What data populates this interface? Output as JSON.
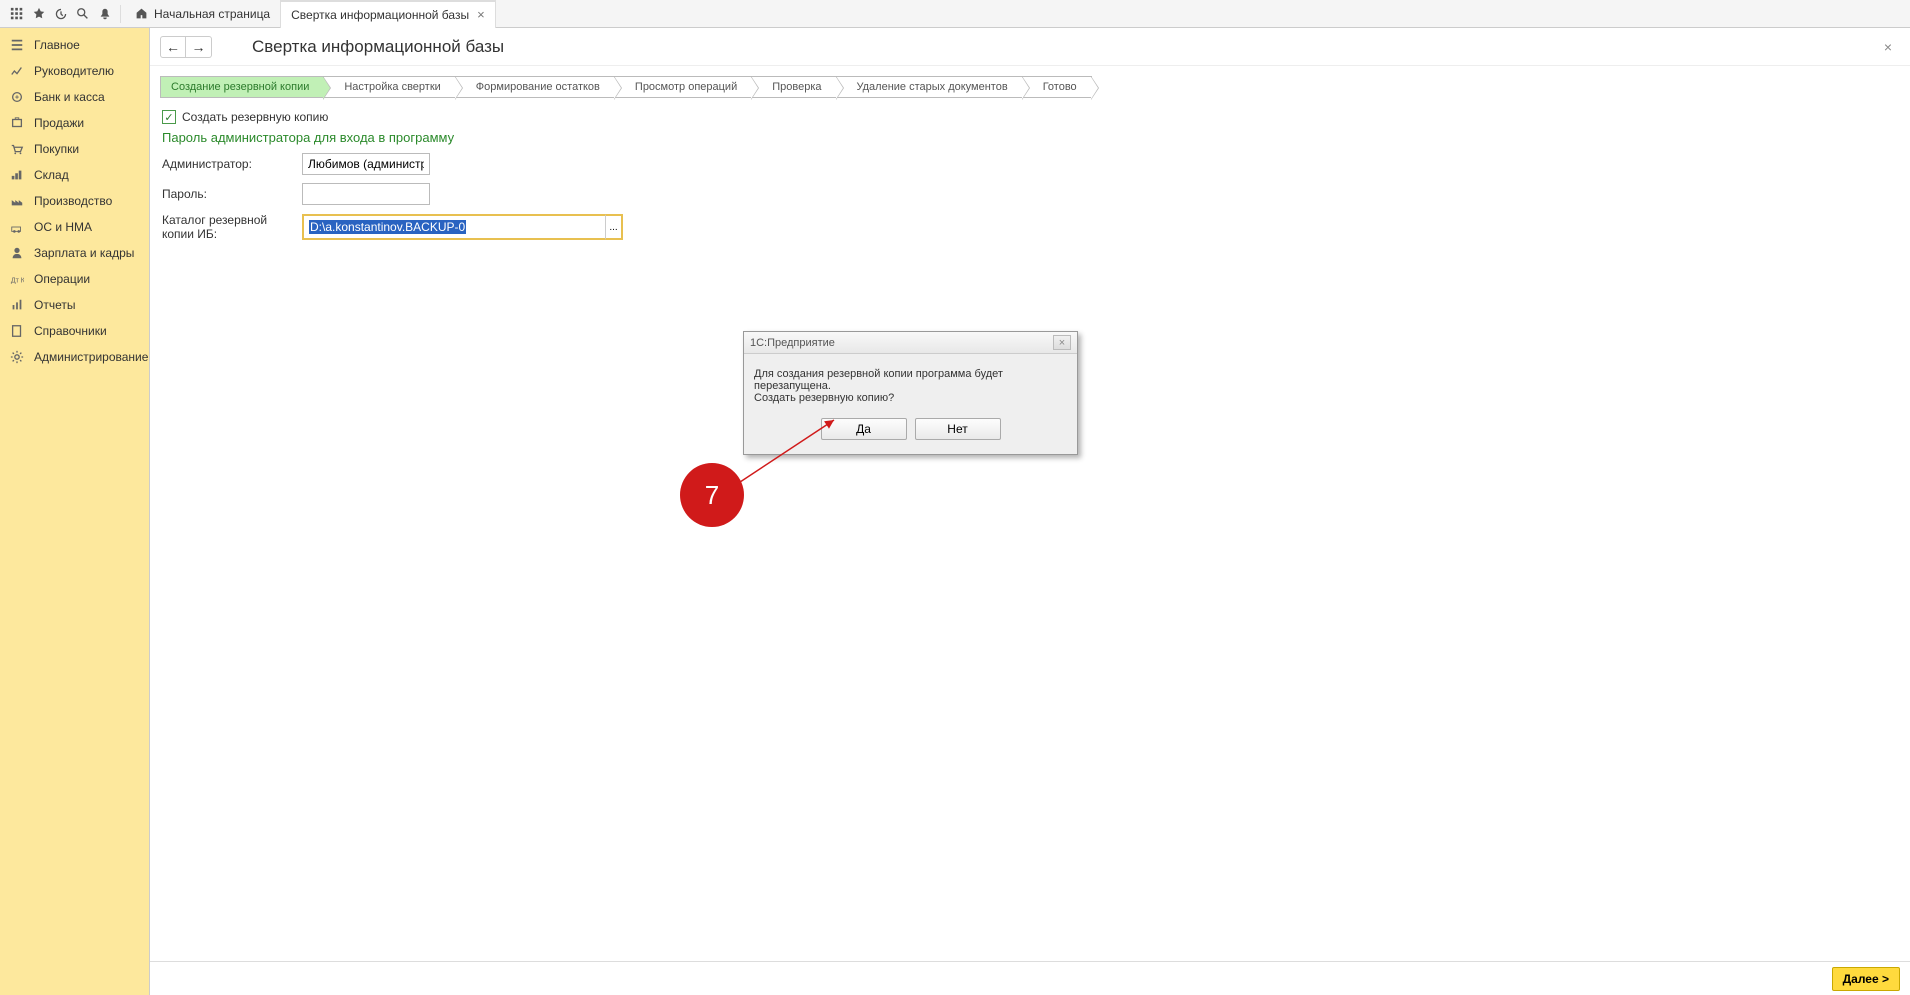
{
  "tabs": {
    "home": "Начальная страница",
    "current": "Свертка информационной базы"
  },
  "sidebar": {
    "items": [
      {
        "label": "Главное"
      },
      {
        "label": "Руководителю"
      },
      {
        "label": "Банк и касса"
      },
      {
        "label": "Продажи"
      },
      {
        "label": "Покупки"
      },
      {
        "label": "Склад"
      },
      {
        "label": "Производство"
      },
      {
        "label": "ОС и НМА"
      },
      {
        "label": "Зарплата и кадры"
      },
      {
        "label": "Операции"
      },
      {
        "label": "Отчеты"
      },
      {
        "label": "Справочники"
      },
      {
        "label": "Администрирование"
      }
    ]
  },
  "page": {
    "title": "Свертка информационной базы"
  },
  "wizard": {
    "steps": [
      "Создание резервной копии",
      "Настройка свертки",
      "Формирование остатков",
      "Просмотр операций",
      "Проверка",
      "Удаление старых документов",
      "Готово"
    ]
  },
  "form": {
    "checkbox_label": "Создать резервную копию",
    "section_title": "Пароль администратора для входа в программу",
    "admin_label": "Администратор:",
    "admin_value": "Любимов (администратор)",
    "pass_label": "Пароль:",
    "pass_value": "",
    "path_label": "Каталог резервной копии ИБ:",
    "path_value": "D:\\a.konstantinov.BACKUP-0",
    "path_btn": "..."
  },
  "dialog": {
    "title": "1С:Предприятие",
    "line1": "Для создания резервной копии программа будет перезапущена.",
    "line2": "Создать резервную копию?",
    "yes": "Да",
    "no": "Нет"
  },
  "annotation": {
    "num": "7"
  },
  "footer": {
    "next": "Далее >"
  }
}
